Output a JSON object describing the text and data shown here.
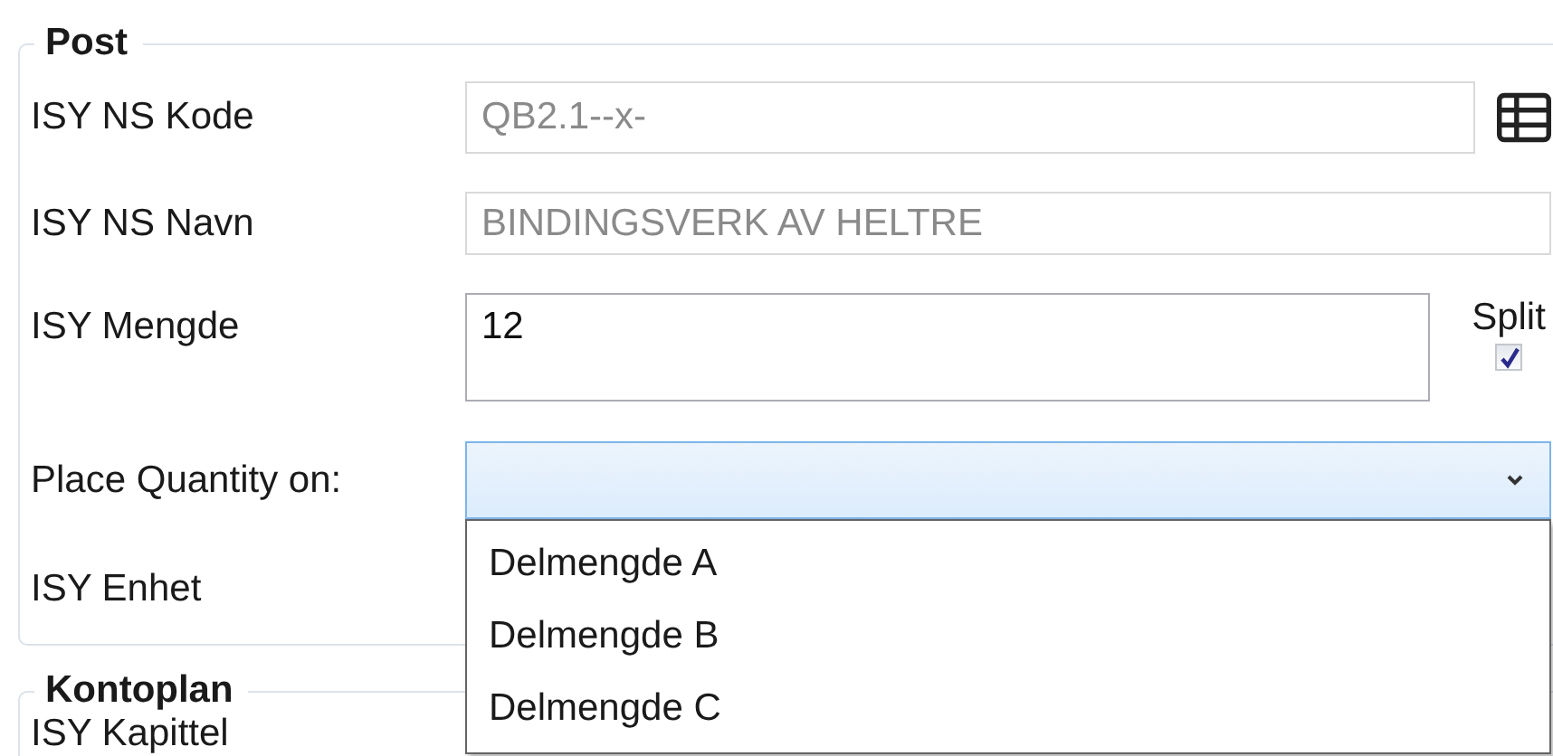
{
  "groups": [
    {
      "title": "Post",
      "rows": [
        {
          "kind": "text",
          "label": "ISY NS Kode",
          "value": "QB2.1--x-",
          "disabled": true,
          "has_picker": true
        },
        {
          "kind": "text",
          "label": "ISY NS Navn",
          "value": "BINDINGSVERK AV HELTRE",
          "disabled": true
        },
        {
          "kind": "multiline",
          "label": "ISY Mengde",
          "value": "12",
          "disabled": false,
          "split": {
            "label": "Split",
            "checked": true
          }
        },
        {
          "kind": "dropdown",
          "label": "Place Quantity on:",
          "expanded": true,
          "options": [
            {
              "label": "Delmengde A",
              "selected": false
            },
            {
              "label": "Delmengde B",
              "selected": false
            },
            {
              "label": "Delmengde C",
              "selected": false
            }
          ]
        },
        {
          "kind": "label_only",
          "label": "ISY Enhet"
        }
      ]
    },
    {
      "title": "Kontoplan",
      "rows": [
        {
          "kind": "label_only",
          "label": "ISY Kapittel"
        }
      ]
    }
  ]
}
